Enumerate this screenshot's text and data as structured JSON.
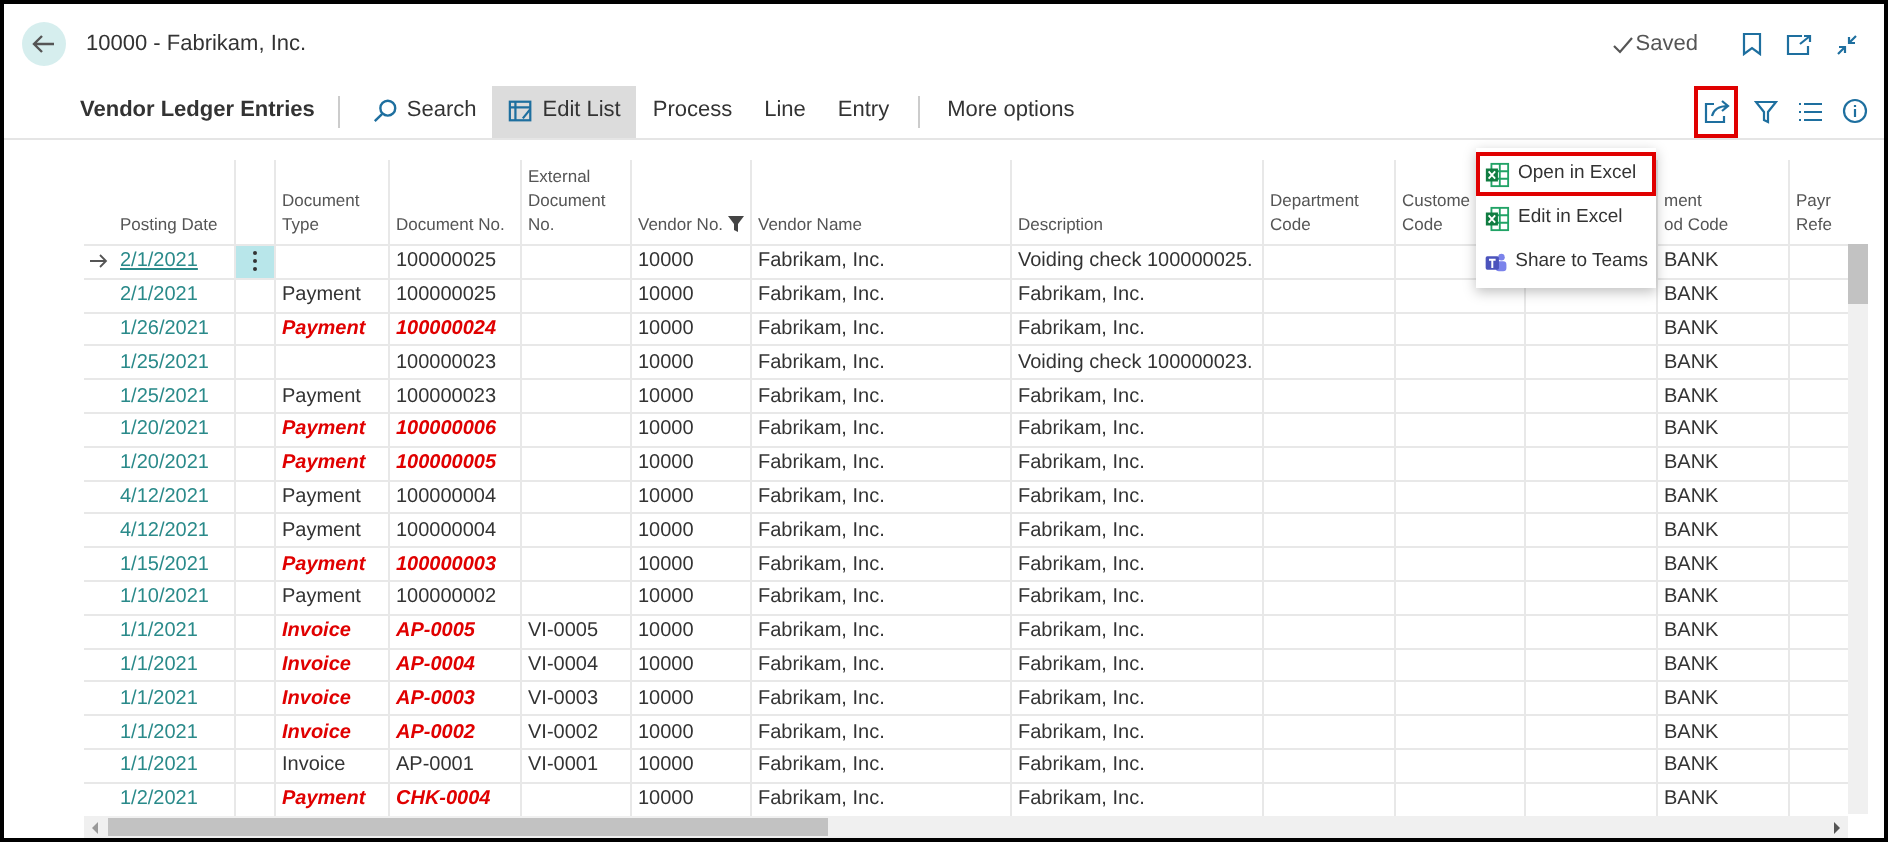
{
  "window": {
    "title": "10000 - Fabrikam, Inc.",
    "status": "Saved"
  },
  "action_bar": {
    "title": "Vendor Ledger Entries",
    "actions": [
      {
        "label": "Search",
        "kind": "search",
        "selected": false
      },
      {
        "label": "Edit List",
        "kind": "edit",
        "selected": true
      },
      {
        "label": "Process",
        "kind": "plain",
        "selected": false
      },
      {
        "label": "Line",
        "kind": "plain",
        "selected": false
      },
      {
        "label": "Entry",
        "kind": "plain",
        "selected": false
      },
      {
        "label": "More options",
        "kind": "more",
        "selected": false
      }
    ],
    "share_highlighted": true
  },
  "menu": {
    "items": [
      {
        "label": "Open in Excel",
        "kind": "excel",
        "highlighted": true
      },
      {
        "label": "Edit in Excel",
        "kind": "excel",
        "highlighted": false
      },
      {
        "label": "Share to Teams",
        "kind": "teams",
        "highlighted": false
      }
    ]
  },
  "table": {
    "columns": [
      {
        "lines": [
          "Posting Date"
        ]
      },
      {
        "lines": [
          "Document",
          "Type"
        ]
      },
      {
        "lines": [
          "Document No."
        ]
      },
      {
        "lines": [
          "External",
          "Document",
          "No."
        ]
      },
      {
        "lines": [
          "Vendor No."
        ]
      },
      {
        "lines": [
          "Vendor Name"
        ]
      },
      {
        "lines": [
          "Description"
        ]
      },
      {
        "lines": [
          "Department",
          "Code"
        ]
      },
      {
        "lines": [
          "Custome",
          "Code"
        ]
      },
      {},
      {
        "lines": [
          "ment",
          "od Code"
        ]
      },
      {
        "lines": [
          "Payr",
          "Refe"
        ]
      }
    ],
    "rows": [
      {
        "current": true,
        "highlighted": false,
        "cells": [
          "2/1/2021",
          "",
          "100000025",
          "",
          "10000",
          "Fabrikam, Inc.",
          "Voiding check 100000025.",
          "",
          "",
          "",
          "BANK",
          ""
        ]
      },
      {
        "current": false,
        "highlighted": false,
        "cells": [
          "2/1/2021",
          "Payment",
          "100000025",
          "",
          "10000",
          "Fabrikam, Inc.",
          "Fabrikam, Inc.",
          "",
          "",
          "",
          "BANK",
          ""
        ]
      },
      {
        "current": false,
        "highlighted": true,
        "cells": [
          "1/26/2021",
          "Payment",
          "100000024",
          "",
          "10000",
          "Fabrikam, Inc.",
          "Fabrikam, Inc.",
          "",
          "",
          "",
          "BANK",
          ""
        ]
      },
      {
        "current": false,
        "highlighted": false,
        "cells": [
          "1/25/2021",
          "",
          "100000023",
          "",
          "10000",
          "Fabrikam, Inc.",
          "Voiding check 100000023.",
          "",
          "",
          "",
          "BANK",
          ""
        ]
      },
      {
        "current": false,
        "highlighted": false,
        "cells": [
          "1/25/2021",
          "Payment",
          "100000023",
          "",
          "10000",
          "Fabrikam, Inc.",
          "Fabrikam, Inc.",
          "",
          "",
          "",
          "BANK",
          ""
        ]
      },
      {
        "current": false,
        "highlighted": true,
        "cells": [
          "1/20/2021",
          "Payment",
          "100000006",
          "",
          "10000",
          "Fabrikam, Inc.",
          "Fabrikam, Inc.",
          "",
          "",
          "",
          "BANK",
          ""
        ]
      },
      {
        "current": false,
        "highlighted": true,
        "cells": [
          "1/20/2021",
          "Payment",
          "100000005",
          "",
          "10000",
          "Fabrikam, Inc.",
          "Fabrikam, Inc.",
          "",
          "",
          "",
          "BANK",
          ""
        ]
      },
      {
        "current": false,
        "highlighted": false,
        "cells": [
          "4/12/2021",
          "Payment",
          "100000004",
          "",
          "10000",
          "Fabrikam, Inc.",
          "Fabrikam, Inc.",
          "",
          "",
          "",
          "BANK",
          ""
        ]
      },
      {
        "current": false,
        "highlighted": false,
        "cells": [
          "4/12/2021",
          "Payment",
          "100000004",
          "",
          "10000",
          "Fabrikam, Inc.",
          "Fabrikam, Inc.",
          "",
          "",
          "",
          "BANK",
          ""
        ]
      },
      {
        "current": false,
        "highlighted": true,
        "cells": [
          "1/15/2021",
          "Payment",
          "100000003",
          "",
          "10000",
          "Fabrikam, Inc.",
          "Fabrikam, Inc.",
          "",
          "",
          "",
          "BANK",
          ""
        ]
      },
      {
        "current": false,
        "highlighted": false,
        "cells": [
          "1/10/2021",
          "Payment",
          "100000002",
          "",
          "10000",
          "Fabrikam, Inc.",
          "Fabrikam, Inc.",
          "",
          "",
          "",
          "BANK",
          ""
        ]
      },
      {
        "current": false,
        "highlighted": true,
        "cells": [
          "1/1/2021",
          "Invoice",
          "AP-0005",
          "VI-0005",
          "10000",
          "Fabrikam, Inc.",
          "Fabrikam, Inc.",
          "",
          "",
          "",
          "BANK",
          ""
        ]
      },
      {
        "current": false,
        "highlighted": true,
        "cells": [
          "1/1/2021",
          "Invoice",
          "AP-0004",
          "VI-0004",
          "10000",
          "Fabrikam, Inc.",
          "Fabrikam, Inc.",
          "",
          "",
          "",
          "BANK",
          ""
        ]
      },
      {
        "current": false,
        "highlighted": true,
        "cells": [
          "1/1/2021",
          "Invoice",
          "AP-0003",
          "VI-0003",
          "10000",
          "Fabrikam, Inc.",
          "Fabrikam, Inc.",
          "",
          "",
          "",
          "BANK",
          ""
        ]
      },
      {
        "current": false,
        "highlighted": true,
        "cells": [
          "1/1/2021",
          "Invoice",
          "AP-0002",
          "VI-0002",
          "10000",
          "Fabrikam, Inc.",
          "Fabrikam, Inc.",
          "",
          "",
          "",
          "BANK",
          ""
        ]
      },
      {
        "current": false,
        "highlighted": false,
        "cells": [
          "1/1/2021",
          "Invoice",
          "AP-0001",
          "VI-0001",
          "10000",
          "Fabrikam, Inc.",
          "Fabrikam, Inc.",
          "",
          "",
          "",
          "BANK",
          ""
        ]
      },
      {
        "current": false,
        "highlighted": true,
        "cells": [
          "1/2/2021",
          "Payment",
          "CHK-0004",
          "",
          "10000",
          "Fabrikam, Inc.",
          "Fabrikam, Inc.",
          "",
          "",
          "",
          "BANK",
          ""
        ]
      }
    ]
  }
}
